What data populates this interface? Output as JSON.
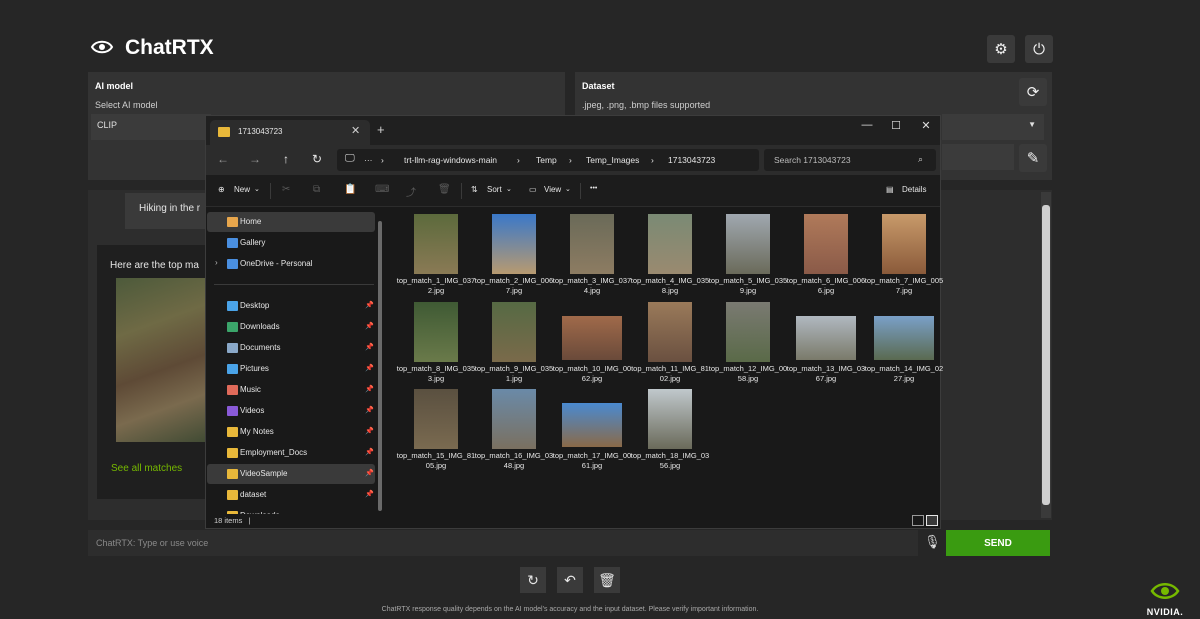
{
  "app": {
    "title": "ChatRTX",
    "settings_icon": "gear-icon",
    "power_icon": "power-icon"
  },
  "ai_model": {
    "title": "AI model",
    "subtitle": "Select AI model",
    "value": "CLIP"
  },
  "dataset": {
    "title": "Dataset",
    "subtitle": ".jpeg, .png, .bmp files supported",
    "refresh_icon": "refresh-icon",
    "edit_icon": "pencil-icon"
  },
  "chat": {
    "user_message": "Hiking in the r",
    "bot_message": "Here are the top ma",
    "see_all": "See all matches",
    "input_placeholder": "ChatRTX: Type or use voice",
    "send_label": "SEND"
  },
  "footer": {
    "disclaimer": "ChatRTX response quality depends on the AI model's accuracy and the input dataset. Please verify important information.",
    "brand": "NVIDIA."
  },
  "explorer": {
    "tab_title": "1713043723",
    "path": [
      "trt-llm-rag-windows-main",
      "Temp",
      "Temp_Images",
      "1713043723"
    ],
    "search_placeholder": "Search 1713043723",
    "commands": {
      "new": "New",
      "sort": "Sort",
      "view": "View",
      "more": "•••",
      "details": "Details"
    },
    "sidebar": [
      {
        "label": "Home",
        "icon": "home-icon",
        "color": "#e7a64c"
      },
      {
        "label": "Gallery",
        "icon": "gallery-icon",
        "color": "#4a8fe0"
      },
      {
        "label": "OneDrive - Personal",
        "icon": "cloud-icon",
        "color": "#4a8fe0"
      },
      {
        "label": "Desktop",
        "icon": "desktop-icon",
        "color": "#4aa3e8"
      },
      {
        "label": "Downloads",
        "icon": "download-icon",
        "color": "#3ba56a"
      },
      {
        "label": "Documents",
        "icon": "document-icon",
        "color": "#8aa8c8"
      },
      {
        "label": "Pictures",
        "icon": "pictures-icon",
        "color": "#4aa3e8"
      },
      {
        "label": "Music",
        "icon": "music-icon",
        "color": "#e06a5a"
      },
      {
        "label": "Videos",
        "icon": "video-icon",
        "color": "#8a5ad8"
      },
      {
        "label": "My Notes",
        "icon": "folder-icon",
        "color": "#e8b83a"
      },
      {
        "label": "Employment_Docs",
        "icon": "folder-icon",
        "color": "#e8b83a"
      },
      {
        "label": "VideoSample",
        "icon": "folder-icon",
        "color": "#e8b83a"
      },
      {
        "label": "dataset",
        "icon": "folder-icon",
        "color": "#e8b83a"
      },
      {
        "label": "Downloads",
        "icon": "folder-icon",
        "color": "#e8b83a"
      }
    ],
    "files": [
      {
        "name": "top_match_1_IMG_0372.jpg",
        "colors": [
          "#5c6a3c",
          "#8a7a55"
        ]
      },
      {
        "name": "top_match_2_IMG_0067.jpg",
        "colors": [
          "#3a78c9",
          "#b89a70"
        ]
      },
      {
        "name": "top_match_3_IMG_0374.jpg",
        "colors": [
          "#6a6a58",
          "#8d7c62"
        ]
      },
      {
        "name": "top_match_4_IMG_0358.jpg",
        "colors": [
          "#7a8a74",
          "#9a8a70"
        ]
      },
      {
        "name": "top_match_5_IMG_0359.jpg",
        "colors": [
          "#a0a8b0",
          "#6a6a5a"
        ]
      },
      {
        "name": "top_match_6_IMG_0066.jpg",
        "colors": [
          "#b07a5a",
          "#8a5a48"
        ]
      },
      {
        "name": "top_match_7_IMG_0057.jpg",
        "colors": [
          "#c89a6a",
          "#8a5a3a"
        ]
      },
      {
        "name": "top_match_8_IMG_0353.jpg",
        "colors": [
          "#3f5a34",
          "#6a7a4a"
        ]
      },
      {
        "name": "top_match_9_IMG_0351.jpg",
        "colors": [
          "#566a44",
          "#7a6a4a"
        ]
      },
      {
        "name": "top_match_10_IMG_0062.jpg",
        "colors": [
          "#a06a4a",
          "#6a4a3a"
        ]
      },
      {
        "name": "top_match_11_IMG_8102.jpg",
        "colors": [
          "#9a7a5a",
          "#6a5040"
        ]
      },
      {
        "name": "top_match_12_IMG_0058.jpg",
        "colors": [
          "#7a7a72",
          "#5a6a48"
        ]
      },
      {
        "name": "top_match_13_IMG_0367.jpg",
        "colors": [
          "#b0b8c0",
          "#7a7a6a"
        ]
      },
      {
        "name": "top_match_14_IMG_0227.jpg",
        "colors": [
          "#7aa0c8",
          "#5a6a50"
        ]
      },
      {
        "name": "top_match_15_IMG_8105.jpg",
        "colors": [
          "#5a5040",
          "#7a6a50"
        ]
      },
      {
        "name": "top_match_16_IMG_0348.jpg",
        "colors": [
          "#6a8aa8",
          "#7a7060"
        ]
      },
      {
        "name": "top_match_17_IMG_0061.jpg",
        "colors": [
          "#4a8ad0",
          "#8a6a48"
        ]
      },
      {
        "name": "top_match_18_IMG_0356.jpg",
        "colors": [
          "#c0c8cc",
          "#6a6a5a"
        ]
      }
    ],
    "item_count": "18 items",
    "item_count_cursor": "|"
  }
}
